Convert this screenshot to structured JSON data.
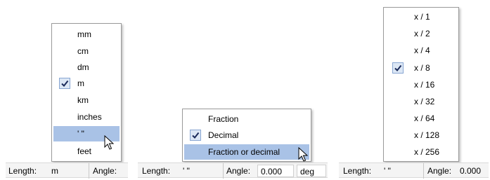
{
  "units_menu": {
    "items": [
      {
        "label": "mm"
      },
      {
        "label": "cm"
      },
      {
        "label": "dm"
      },
      {
        "label": "m",
        "checked": true
      },
      {
        "label": "km"
      },
      {
        "label": "inches"
      },
      {
        "label": "' \"",
        "highlighted": true
      },
      {
        "label": "feet"
      }
    ]
  },
  "format_menu": {
    "items": [
      {
        "label": "Fraction"
      },
      {
        "label": "Decimal",
        "checked": true
      },
      {
        "label": "Fraction or decimal",
        "highlighted": true
      }
    ]
  },
  "precision_menu": {
    "items": [
      {
        "label": "x / 1"
      },
      {
        "label": "x / 2"
      },
      {
        "label": "x / 4"
      },
      {
        "label": "x / 8",
        "checked": true
      },
      {
        "label": "x / 16"
      },
      {
        "label": "x / 32"
      },
      {
        "label": "x / 64"
      },
      {
        "label": "x / 128"
      },
      {
        "label": "x / 256"
      }
    ]
  },
  "bar1": {
    "length_label": "Length:",
    "length_value": "m",
    "angle_label": "Angle:"
  },
  "bar2": {
    "length_label": "Length:",
    "length_value": "' \"",
    "angle_label": "Angle:",
    "angle_value": "0.000",
    "angle_unit": "deg"
  },
  "bar3": {
    "length_label": "Length:",
    "length_value": "' \"",
    "angle_label": "Angle:",
    "angle_value": "0.000"
  },
  "colors": {
    "highlight": "#a9c2e6",
    "check_bg": "#dce7f5",
    "check_border": "#88a6d2",
    "bar_bg": "#f4f4f4"
  }
}
